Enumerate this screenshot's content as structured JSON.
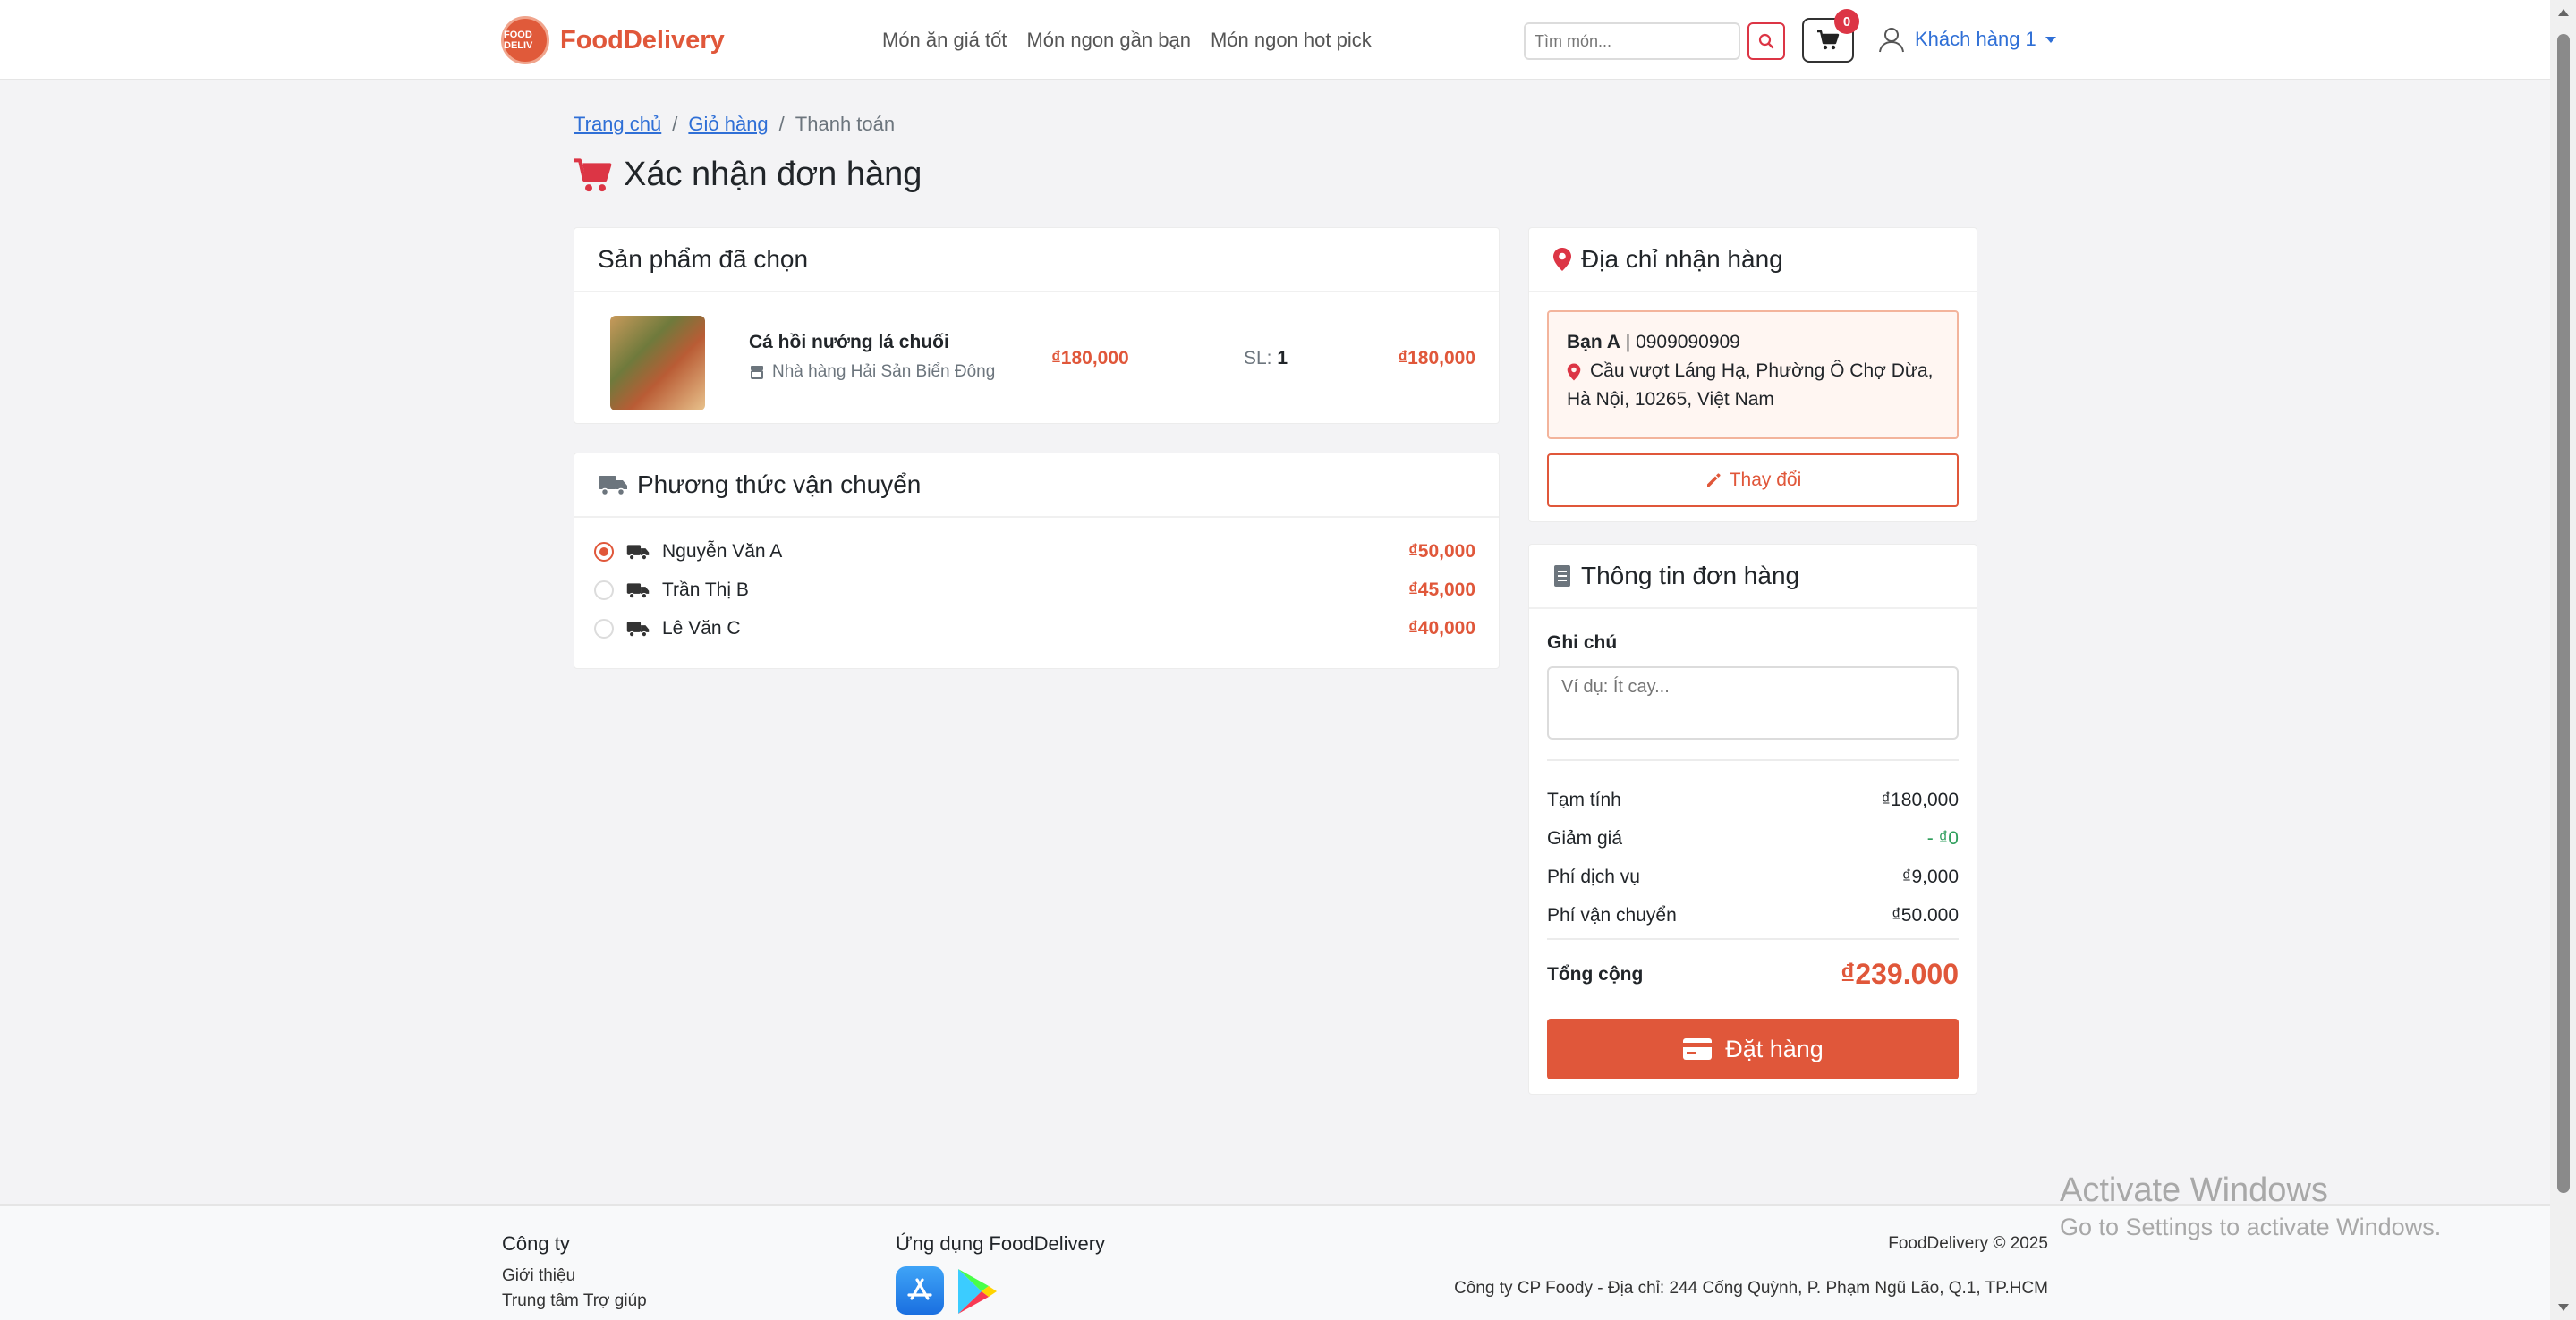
{
  "header": {
    "brand": "FoodDelivery",
    "logo_text": "FOOD DELIV",
    "nav": [
      "Món ăn giá tốt",
      "Món ngon gần bạn",
      "Món ngon hot pick"
    ],
    "search_placeholder": "Tìm món...",
    "cart_count": "0",
    "user_name": "Khách hàng 1"
  },
  "breadcrumb": {
    "home": "Trang chủ",
    "cart": "Giỏ hàng",
    "current": "Thanh toán"
  },
  "page_title": "Xác nhận đơn hàng",
  "products": {
    "title": "Sản phẩm đã chọn",
    "items": [
      {
        "name": "Cá hồi nướng lá chuối",
        "shop": "Nhà hàng Hải Sản Biển Đông",
        "price": "₫180,000",
        "qty_label": "SL:",
        "qty": "1",
        "total": "₫180,000"
      }
    ]
  },
  "shipping": {
    "title": "Phương thức vận chuyển",
    "options": [
      {
        "name": "Nguyễn Văn A",
        "price": "₫50,000",
        "selected": true
      },
      {
        "name": "Trần Thị B",
        "price": "₫45,000",
        "selected": false
      },
      {
        "name": "Lê Văn C",
        "price": "₫40,000",
        "selected": false
      }
    ]
  },
  "address": {
    "title": "Địa chỉ nhận hàng",
    "name": "Bạn A",
    "phone": "0909090909",
    "separator": "|",
    "line1": "Cầu vượt Láng Hạ, Phường Ô Chợ Dừa,",
    "line2": "Hà Nội, 10265, Việt Nam",
    "change_label": "Thay đổi"
  },
  "order": {
    "title": "Thông tin đơn hàng",
    "note_label": "Ghi chú",
    "note_placeholder": "Ví dụ: Ít cay...",
    "rows": [
      {
        "label": "Tạm tính",
        "value": "₫180,000"
      },
      {
        "label": "Giảm giá",
        "value": "- ₫0"
      },
      {
        "label": "Phí dịch vụ",
        "value": "₫9,000"
      },
      {
        "label": "Phí vận chuyển",
        "value": "₫50.000"
      }
    ],
    "total_label": "Tổng cộng",
    "total_value": "₫239.000",
    "submit_label": "Đặt hàng"
  },
  "footer": {
    "company_title": "Công ty",
    "links": [
      "Giới thiệu",
      "Trung tâm Trợ giúp"
    ],
    "app_title": "Ứng dụng FoodDelivery",
    "copyright": "FoodDelivery © 2025",
    "address": "Công ty CP Foody - Địa chỉ: 244 Cống Quỳnh, P. Phạm Ngũ Lão, Q.1, TP.HCM"
  },
  "watermark": {
    "line1": "Activate Windows",
    "line2": "Go to Settings to activate Windows."
  },
  "colors": {
    "accent": "#e0573a",
    "link": "#2f6fd6",
    "danger": "#dc3545"
  }
}
